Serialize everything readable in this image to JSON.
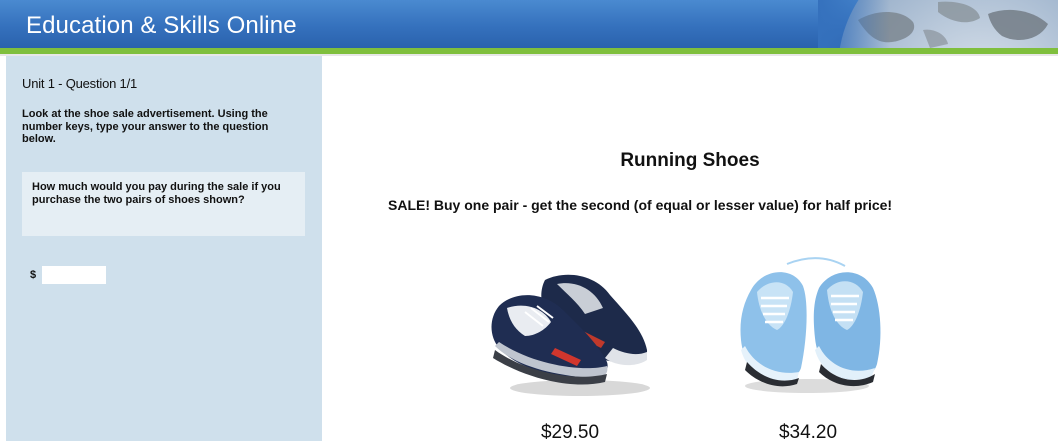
{
  "header": {
    "title": "Education & Skills Online"
  },
  "sidebar": {
    "unit_label": "Unit 1 - Question 1/1",
    "instructions": "Look at the shoe sale advertisement. Using the number keys, type your answer to the question below.",
    "question": "How much would you pay during the sale if you purchase the two pairs of shoes shown?",
    "currency_symbol": "$",
    "answer_value": ""
  },
  "ad": {
    "title": "Running Shoes",
    "sale_text": "SALE! Buy one pair - get the second (of equal or lesser value) for half price!",
    "products": [
      {
        "icon": "running-shoe-navy-icon",
        "price": "$29.50"
      },
      {
        "icon": "running-shoe-lightblue-icon",
        "price": "$34.20"
      }
    ]
  },
  "colors": {
    "header_blue": "#3571bd",
    "accent_green": "#7fbf3d",
    "sidebar_bg": "#cfe0ec",
    "question_bg": "#e5eef4"
  }
}
